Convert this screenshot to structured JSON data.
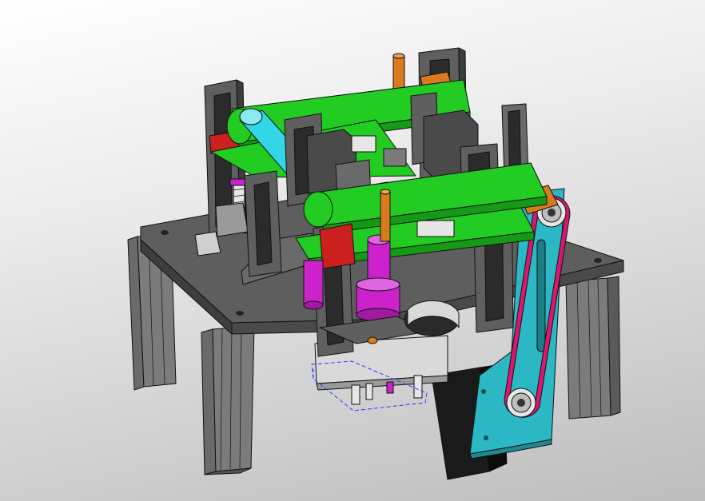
{
  "viewport": {
    "background_top": "#ffffff",
    "background_bottom": "#bcbcbc"
  },
  "colors": {
    "frame": "#5f5f5f",
    "frame_light": "#8a8a8a",
    "frame_dark": "#3d3d3d",
    "arm_green": "#22cc22",
    "arm_green_dark": "#149a14",
    "roller_cyan": "#33d6e6",
    "cylinder_magenta": "#cc22cc",
    "rod_orange": "#d97a1e",
    "bracket_red": "#cc1f1f",
    "belt_plate_teal": "#2bb8c4",
    "belt_pink": "#d8186e",
    "motor_black": "#1a1a1a",
    "sketch_blue": "#2a3cff"
  },
  "model": {
    "name": "",
    "parts": [
      "base-plate",
      "aluminum-extrusion-legs",
      "vertical-guide-frames",
      "green-swing-arms",
      "cyan-roller",
      "magenta-pneumatic-cylinders",
      "orange-piston-rods",
      "red-mount-brackets",
      "teal-belt-plate",
      "timing-belt",
      "pulleys",
      "stepper-motor"
    ]
  }
}
